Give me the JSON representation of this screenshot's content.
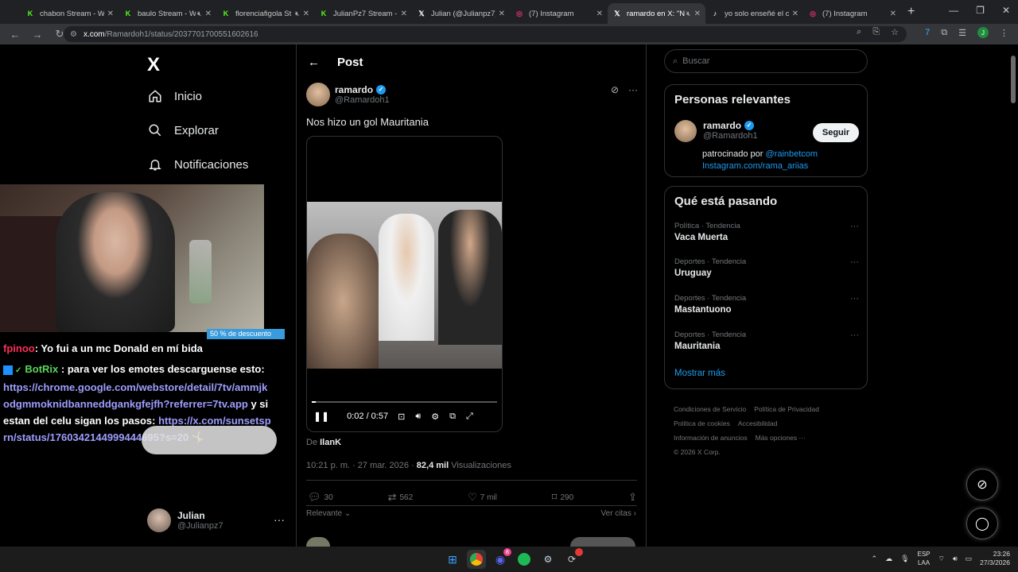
{
  "browser": {
    "tabs": [
      {
        "title": "chabon Stream - Wa",
        "fav": "K",
        "fav_color": "#53fc18",
        "muted": false
      },
      {
        "title": "baulo Stream - W",
        "fav": "K",
        "fav_color": "#53fc18",
        "muted": true
      },
      {
        "title": "florenciafigola St",
        "fav": "K",
        "fav_color": "#53fc18",
        "muted": true
      },
      {
        "title": "JulianPz7 Stream - Ki",
        "fav": "K",
        "fav_color": "#53fc18",
        "muted": false
      },
      {
        "title": "Julian (@Julianpz7) /",
        "fav": "𝕏",
        "fav_color": "#ffffff",
        "muted": false
      },
      {
        "title": "(7) Instagram",
        "fav": "◎",
        "fav_color": "#e1306c",
        "muted": false
      },
      {
        "title": "ramardo en X: \"N",
        "fav": "𝕏",
        "fav_color": "#ffffff",
        "muted": true,
        "active": true
      },
      {
        "title": "yo solo enseñé el cor",
        "fav": "♪",
        "fav_color": "#ffffff",
        "muted": false
      },
      {
        "title": "(7) Instagram",
        "fav": "◎",
        "fav_color": "#e1306c",
        "muted": false
      }
    ],
    "url_domain": "x.com",
    "url_path": "/Ramardoh1/status/2037701700551602616"
  },
  "left_nav": {
    "logo": "X",
    "items": [
      {
        "label": "Inicio",
        "icon": "home-icon"
      },
      {
        "label": "Explorar",
        "icon": "search-icon"
      },
      {
        "label": "Notificaciones",
        "icon": "bell-icon"
      }
    ],
    "discount_label": "50 % de descuento"
  },
  "chat": {
    "messages": [
      {
        "user": "fpinoo",
        "text": ": Yo fui a un mc Donald en mí bida"
      },
      {
        "user": "BotRix",
        "text": ": para ver los emotes descarguense esto:",
        "link": "https://chrome.google.com/webstore/detail/7tv/ammjkodgmmoknidbanneddgankgfejfh?referrer=7tv.app",
        "text2": "y si estan del celu sigan los pasos:",
        "link2": "https://x.com/sunsetsprn/status/1760342144999444695?s=20"
      }
    ]
  },
  "account": {
    "name": "Julian",
    "handle": "@Julianpz7"
  },
  "post": {
    "header_title": "Post",
    "author_name": "ramardo",
    "author_handle": "@Ramardoh1",
    "text": "Nos hizo un gol Mauritania",
    "video_time": "0:02 / 0:57",
    "video_progress": 0.02,
    "credit_prefix": "De",
    "credit_name": "IlanK",
    "timestamp": "10:21 p. m. · 27 mar. 2026 · ",
    "views_count": "82,4 mil",
    "views_label": "Visualizaciones",
    "replies": "30",
    "reposts": "562",
    "likes": "7 mil",
    "bookmarks": "290",
    "sort_label": "Relevante",
    "quotes_label": "Ver citas"
  },
  "right": {
    "search_placeholder": "Buscar",
    "relevant_title": "Personas relevantes",
    "rel_name": "ramardo",
    "rel_handle": "@Ramardoh1",
    "follow_label": "Seguir",
    "bio_text": "patrocinado por ",
    "bio_link1": "@rainbetcom",
    "bio_link2": "Instagram.com/rama_ariias",
    "trends_title": "Qué está pasando",
    "trends": [
      {
        "category": "Política · Tendencia",
        "title": "Vaca Muerta"
      },
      {
        "category": "Deportes · Tendencia",
        "title": "Uruguay"
      },
      {
        "category": "Deportes · Tendencia",
        "title": "Mastantuono"
      },
      {
        "category": "Deportes · Tendencia",
        "title": "Mauritania"
      }
    ],
    "show_more": "Mostrar más",
    "footer_links": [
      "Condiciones de Servicio",
      "Política de Privacidad",
      "Política de cookies",
      "Accesibilidad",
      "Información de anuncios",
      "Más opciones ···",
      "© 2026 X Corp."
    ]
  },
  "taskbar": {
    "lang_line1": "ESP",
    "lang_line2": "LAA",
    "time": "23:26",
    "date": "27/3/2026",
    "discord_badge": "8"
  }
}
